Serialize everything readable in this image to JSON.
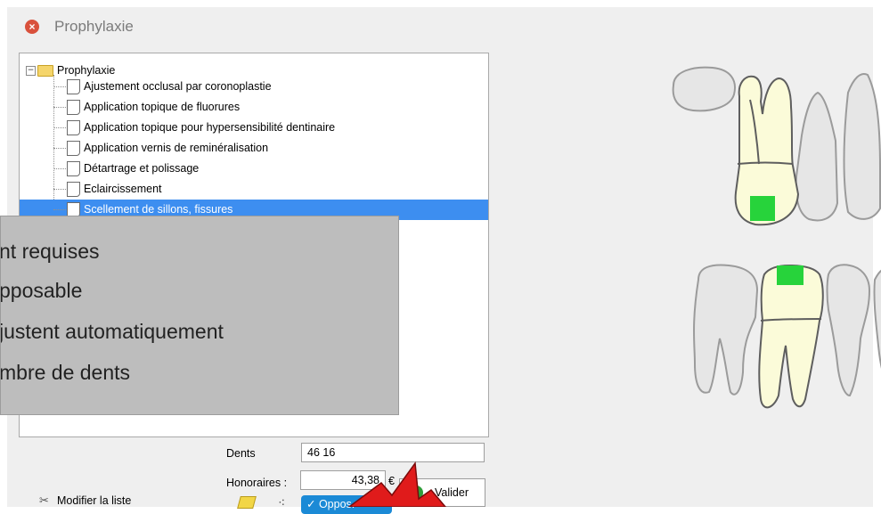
{
  "window": {
    "title": "Prophylaxie",
    "close_icon": "close-icon"
  },
  "tree": {
    "root_label": "Prophylaxie",
    "items": [
      {
        "label": "Ajustement occlusal par coronoplastie"
      },
      {
        "label": "Application topique de fluorures"
      },
      {
        "label": "Application topique pour hypersensibilité dentinaire"
      },
      {
        "label": "Application vernis de reminéralisation"
      },
      {
        "label": "Détartrage et polissage"
      },
      {
        "label": "Eclaircissement"
      },
      {
        "label": "Scellement de sillons, fissures"
      }
    ],
    "selected_index": 6
  },
  "tooltip": {
    "lines": [
      "nt requises",
      "pposable",
      "justent automatiquement",
      "mbre de dents"
    ]
  },
  "form": {
    "dents_label": "Dents",
    "dents_value": "46 16",
    "honoraires_label": "Honoraires :",
    "honoraires_value": "43,38",
    "currency": "€",
    "validate_label": "Valider",
    "oppos_label": "✓ Oppos.",
    "modify_label": "Modifier la liste"
  },
  "colors": {
    "selection": "#3d8ef0",
    "marker": "#27d33b",
    "tooth_fill": "#fbfbd9",
    "arrow": "#e01b1b"
  }
}
